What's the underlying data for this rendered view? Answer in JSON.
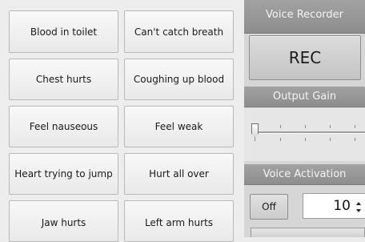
{
  "phrases": [
    "Blood in toilet",
    "Can't catch breath",
    "Chest hurts",
    "Coughing up blood",
    "Feel nauseous",
    "Feel weak",
    "Heart trying to jump",
    "Hurt all over",
    "Jaw hurts",
    "Left arm hurts"
  ],
  "voice_recorder": {
    "title": "Voice Recorder",
    "rec_label": "REC"
  },
  "output_gain": {
    "title": "Output Gain",
    "level": 0
  },
  "voice_activation": {
    "title": "Voice Activation",
    "off_label": "Off",
    "value": "10"
  }
}
